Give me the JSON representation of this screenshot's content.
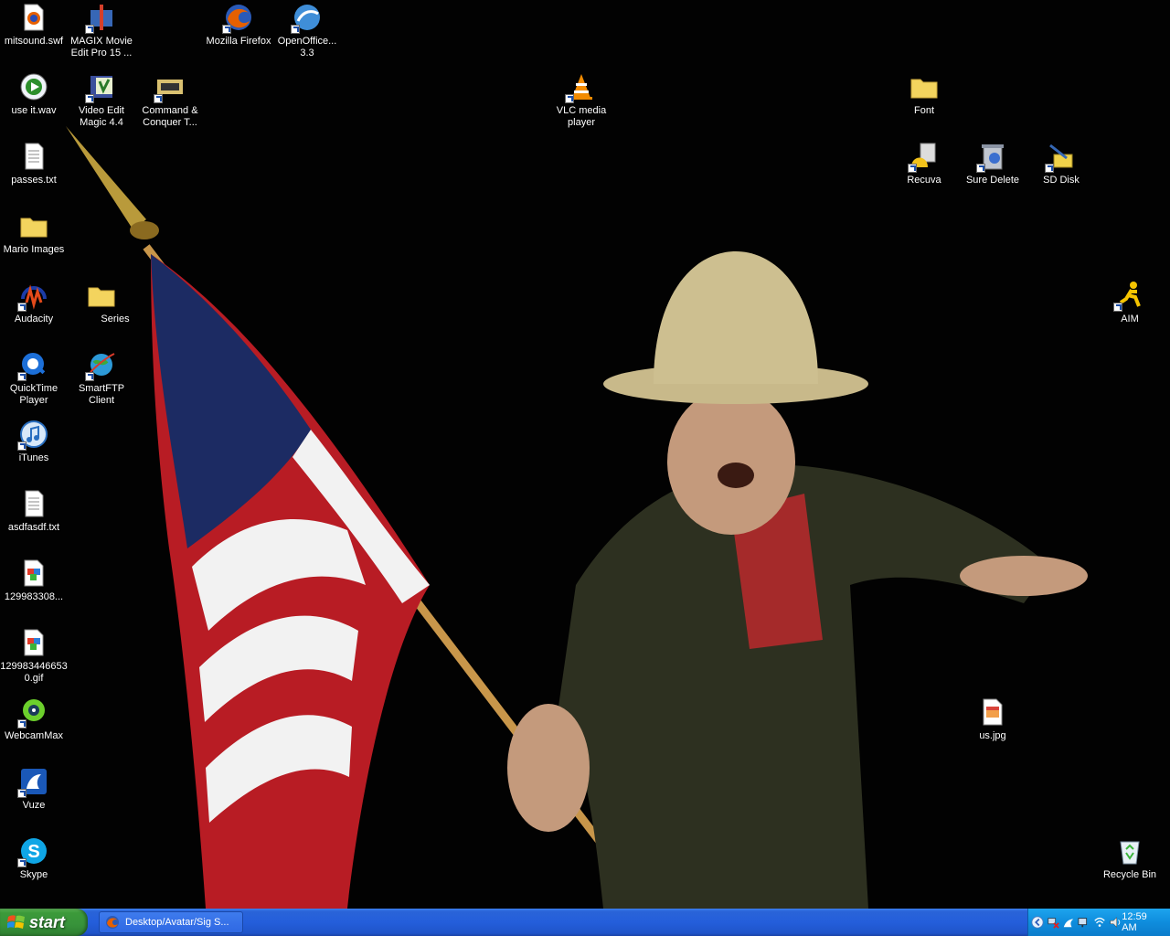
{
  "desktop": {
    "icons": [
      {
        "label": "mitsound.swf"
      },
      {
        "label": "MAGIX Movie Edit Pro 15 ..."
      },
      {
        "label": "Mozilla Firefox"
      },
      {
        "label": "OpenOffice... 3.3"
      },
      {
        "label": "use it.wav"
      },
      {
        "label": "Video Edit Magic 4.4"
      },
      {
        "label": "Command & Conquer T..."
      },
      {
        "label": "VLC media player"
      },
      {
        "label": "Font"
      },
      {
        "label": "passes.txt"
      },
      {
        "label": "Recuva"
      },
      {
        "label": "Sure Delete"
      },
      {
        "label": "SD Disk"
      },
      {
        "label": "Mario Images"
      },
      {
        "label": "Audacity"
      },
      {
        "label": "Series"
      },
      {
        "label": "AIM"
      },
      {
        "label": "QuickTime Player"
      },
      {
        "label": "SmartFTP Client"
      },
      {
        "label": "iTunes"
      },
      {
        "label": "asdfasdf.txt"
      },
      {
        "label": "129983308..."
      },
      {
        "label": "1299834466530.gif"
      },
      {
        "label": "WebcamMax"
      },
      {
        "label": "us.jpg"
      },
      {
        "label": "Vuze"
      },
      {
        "label": "Skype"
      },
      {
        "label": "Recycle Bin"
      }
    ]
  },
  "taskbar": {
    "start_label": "start",
    "task_label": "Desktop/Avatar/Sig S...",
    "clock": "12:59 AM"
  }
}
